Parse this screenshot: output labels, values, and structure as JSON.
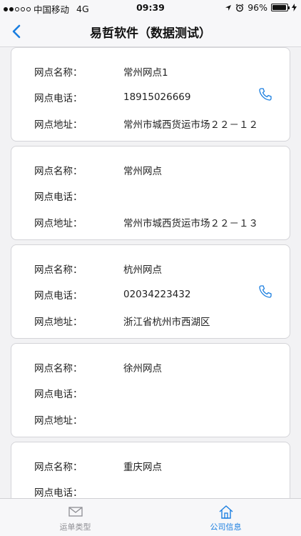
{
  "status_bar": {
    "carrier": "中国移动",
    "network": "4G",
    "time": "09:39",
    "battery": "96%",
    "battery_level": 0.96
  },
  "nav": {
    "title": "易哲软件（数据测试）"
  },
  "labels": {
    "name": "网点名称：",
    "phone": "网点电话：",
    "address": "网点地址："
  },
  "branches": [
    {
      "name": "常州网点1",
      "phone": "18915026669",
      "address": "常州市城西货运市场２２－１２",
      "has_phone": true
    },
    {
      "name": "常州网点",
      "phone": "",
      "address": "常州市城西货运市场２２－１３",
      "has_phone": false
    },
    {
      "name": "杭州网点",
      "phone": "02034223432",
      "address": "浙江省杭州市西湖区",
      "has_phone": true
    },
    {
      "name": "徐州网点",
      "phone": "",
      "address": "",
      "has_phone": false
    },
    {
      "name": "重庆网点",
      "phone": "",
      "address": "",
      "has_phone": false
    }
  ],
  "tabs": [
    {
      "label": "运单类型",
      "icon": "envelope-icon",
      "active": false
    },
    {
      "label": "公司信息",
      "icon": "home-icon",
      "active": true
    }
  ],
  "colors": {
    "accent": "#1a7ee0",
    "inactive": "#8e8e93"
  }
}
